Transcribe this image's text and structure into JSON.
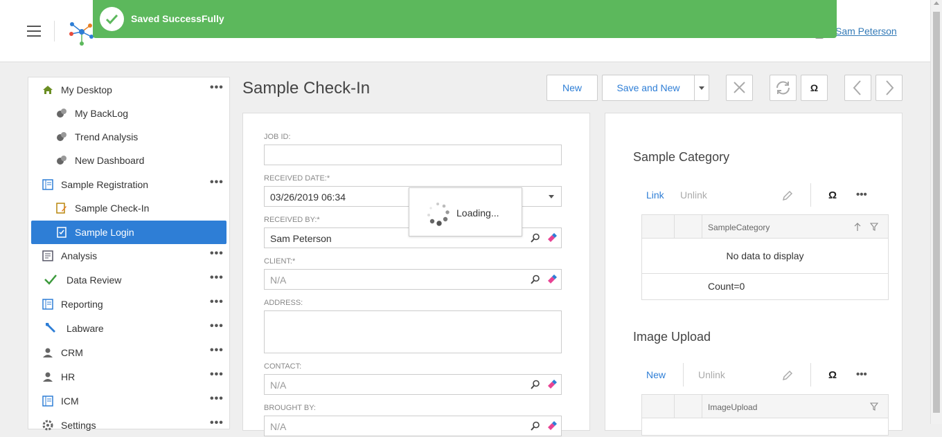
{
  "toast": {
    "message": "Saved SuccessFully"
  },
  "header": {
    "user_name": "Sam Peterson"
  },
  "sidebar": {
    "items": [
      {
        "label": "My Desktop"
      },
      {
        "label": "My BackLog"
      },
      {
        "label": "Trend Analysis"
      },
      {
        "label": "New Dashboard"
      },
      {
        "label": "Sample Registration"
      },
      {
        "label": "Sample Check-In"
      },
      {
        "label": "Sample Login"
      },
      {
        "label": "Analysis"
      },
      {
        "label": "Data Review"
      },
      {
        "label": "Reporting"
      },
      {
        "label": "Labware"
      },
      {
        "label": "CRM"
      },
      {
        "label": "HR"
      },
      {
        "label": "ICM"
      },
      {
        "label": "Settings"
      }
    ],
    "more_label": "•••"
  },
  "page": {
    "title": "Sample Check-In"
  },
  "toolbar": {
    "new_label": "New",
    "save_and_new_label": "Save and New",
    "omega_label": "Ω"
  },
  "form": {
    "job_id_label": "JOB ID:",
    "job_id_value": "",
    "received_date_label": "RECEIVED DATE:*",
    "received_date_value": "03/26/2019 06:34",
    "received_by_label": "RECEIVED BY:*",
    "received_by_value": "Sam Peterson",
    "client_label": "CLIENT:*",
    "client_placeholder": "N/A",
    "address_label": "ADDRESS:",
    "contact_label": "CONTACT:",
    "contact_placeholder": "N/A",
    "brought_by_label": "BROUGHT BY:",
    "brought_by_placeholder": "N/A"
  },
  "loading": {
    "text": "Loading..."
  },
  "sample_category": {
    "title": "Sample Category",
    "link_label": "Link",
    "unlink_label": "Unlink",
    "omega_label": "Ω",
    "more_label": "•••",
    "column_header": "SampleCategory",
    "empty_text": "No data to display",
    "count_text": "Count=0"
  },
  "image_upload": {
    "title": "Image Upload",
    "new_label": "New",
    "unlink_label": "Unlink",
    "omega_label": "Ω",
    "more_label": "•••",
    "column_header": "ImageUpload"
  },
  "colors": {
    "accent": "#2e7ed6",
    "toast": "#5cb85c",
    "link": "#337ab7"
  }
}
